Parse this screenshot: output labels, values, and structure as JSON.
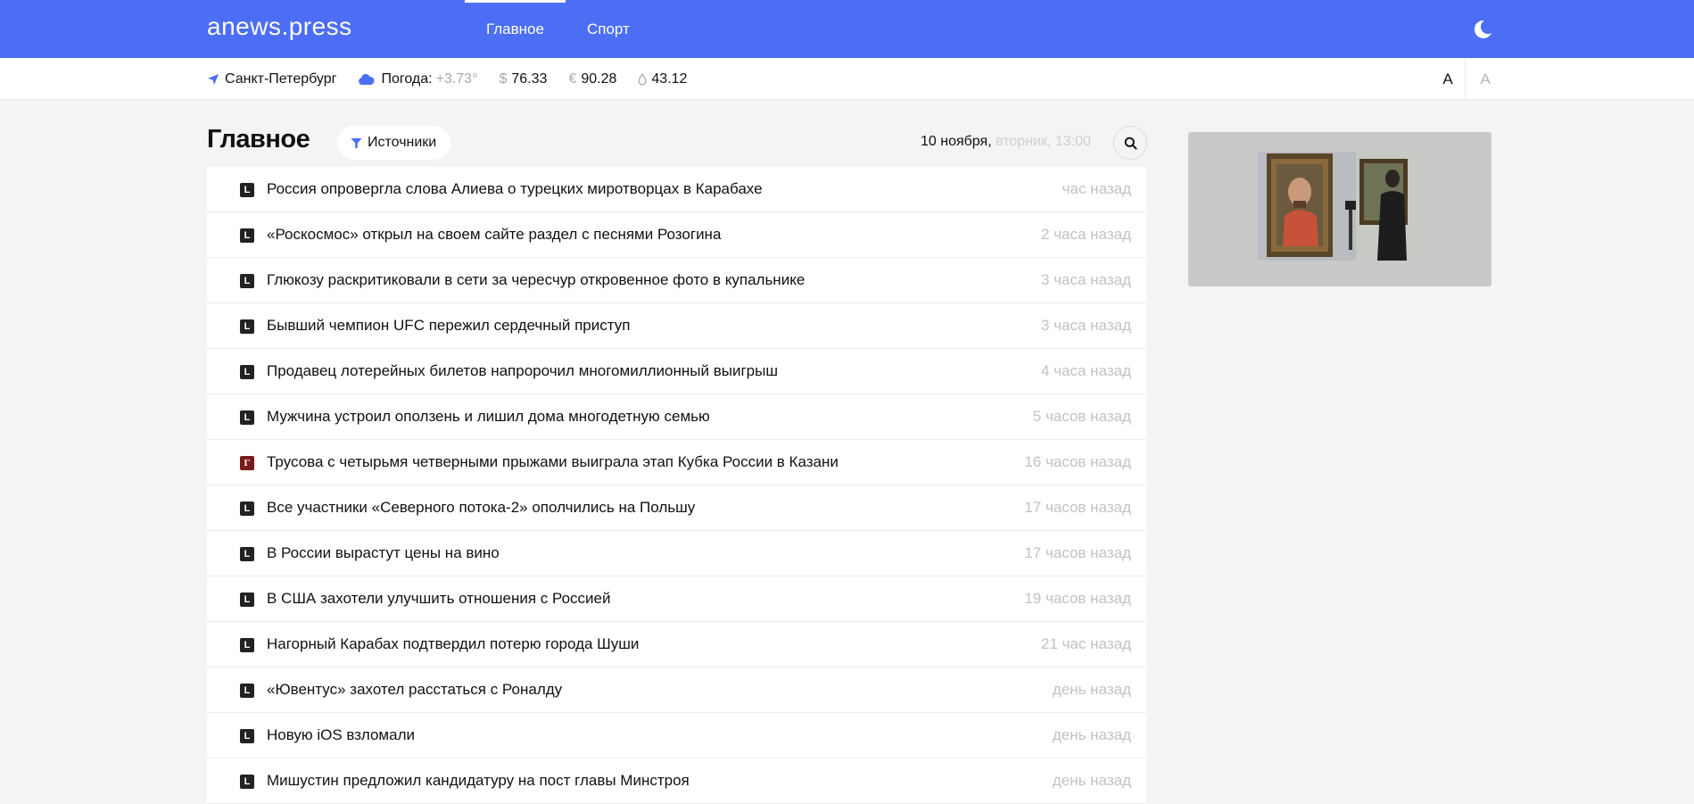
{
  "header": {
    "logo": "anews.press",
    "nav": [
      {
        "label": "Главное",
        "active": true
      },
      {
        "label": "Спорт",
        "active": false
      }
    ],
    "theme_icon": "moon-icon",
    "accent_color": "#4c6ef5"
  },
  "infobar": {
    "city": "Санкт-Петербург",
    "weather_label": "Погода:",
    "weather_value": "+3.73°",
    "usd_symbol": "$",
    "usd_value": "76.33",
    "eur_symbol": "€",
    "eur_value": "90.28",
    "oil_value": "43.12",
    "font_large": "A",
    "font_small": "A"
  },
  "main": {
    "title": "Главное",
    "sources_label": "Источники",
    "date_main": "10 ноября,",
    "date_sub": "вторник, 13:00",
    "news": [
      {
        "source": "L",
        "title": "Россия опровергла слова Алиева о турецких миротворцах в Карабахе",
        "time": "час назад"
      },
      {
        "source": "L",
        "title": "«Роскосмос» открыл на своем сайте раздел с песнями Розогина",
        "time": "2 часа назад"
      },
      {
        "source": "L",
        "title": "Глюкозу раскритиковали в сети за чересчур откровенное фото в купальнике",
        "time": "3 часа назад"
      },
      {
        "source": "L",
        "title": "Бывший чемпион UFC пережил сердечный приступ",
        "time": "3 часа назад"
      },
      {
        "source": "L",
        "title": "Продавец лотерейных билетов напророчил многомиллионный выигрыш",
        "time": "4 часа назад"
      },
      {
        "source": "L",
        "title": "Мужчина устроил оползень и лишил дома многодетную семью",
        "time": "5 часов назад"
      },
      {
        "source": "Г",
        "title": "Трусова с четырьмя четверными прыжами выиграла этап Кубка России в Казани",
        "time": "16 часов назад"
      },
      {
        "source": "L",
        "title": "Все участники «Северного потока-2» ополчились на Польшу",
        "time": "17 часов назад"
      },
      {
        "source": "L",
        "title": "В России вырастут цены на вино",
        "time": "17 часов назад"
      },
      {
        "source": "L",
        "title": "В США захотели улучшить отношения с Россией",
        "time": "19 часов назад"
      },
      {
        "source": "L",
        "title": "Нагорный Карабах подтвердил потерю города Шуши",
        "time": "21 час назад"
      },
      {
        "source": "L",
        "title": "«Ювентус» захотел расстаться с Роналду",
        "time": "день назад"
      },
      {
        "source": "L",
        "title": "Новую iOS взломали",
        "time": "день назад"
      },
      {
        "source": "L",
        "title": "Мишустин предложил кандидатуру на пост главы Минстроя",
        "time": "день назад"
      }
    ]
  }
}
